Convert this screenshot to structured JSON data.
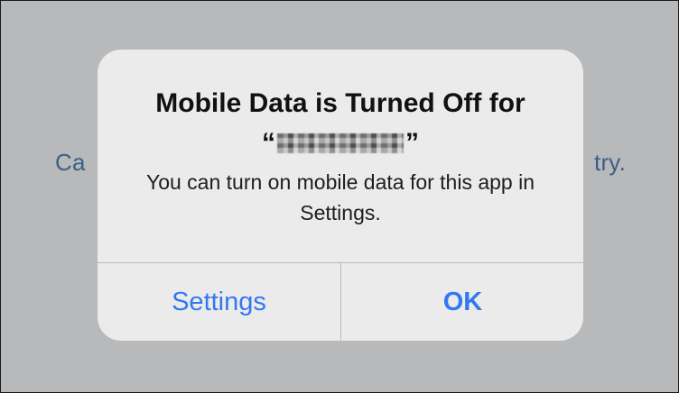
{
  "background": {
    "text_left": "Ca",
    "text_right": "try."
  },
  "alert": {
    "title_line1": "Mobile Data is Turned Off for",
    "quote_open": "“",
    "quote_close": "”",
    "message": "You can turn on mobile data for this app in Settings.",
    "buttons": {
      "settings_label": "Settings",
      "ok_label": "OK"
    }
  },
  "colors": {
    "overlay": "#b7b9bb",
    "alert_bg": "#ebebec",
    "button_text": "#3478f0",
    "background_text": "#3c5f86"
  }
}
